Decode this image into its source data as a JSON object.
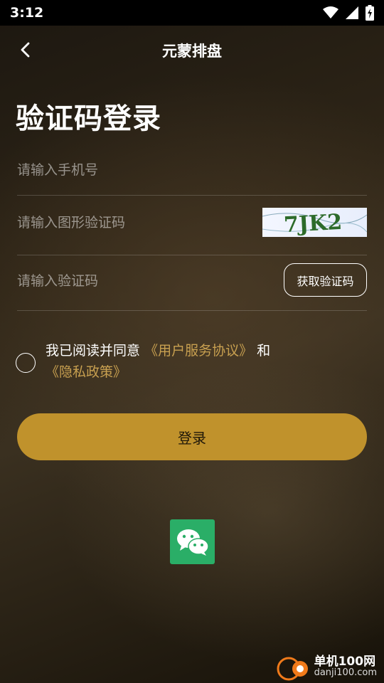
{
  "status_bar": {
    "time": "3:12"
  },
  "app_bar": {
    "title": "元蒙排盘"
  },
  "page": {
    "heading": "验证码登录"
  },
  "form": {
    "phone_placeholder": "请输入手机号",
    "captcha_placeholder": "请输入图形验证码",
    "captcha_text": "7JK2",
    "code_placeholder": "请输入验证码",
    "get_code_label": "获取验证码"
  },
  "agreement": {
    "prefix": "我已阅读并同意",
    "user_agreement": "《用户服务协议》",
    "and": "和",
    "privacy_policy": "《隐私政策》"
  },
  "login_label": "登录",
  "watermark": {
    "brand": "单机100网",
    "domain": "danji100.com"
  },
  "colors": {
    "accent": "#c0922c",
    "link": "#c8a050",
    "wechat": "#2aae67"
  }
}
